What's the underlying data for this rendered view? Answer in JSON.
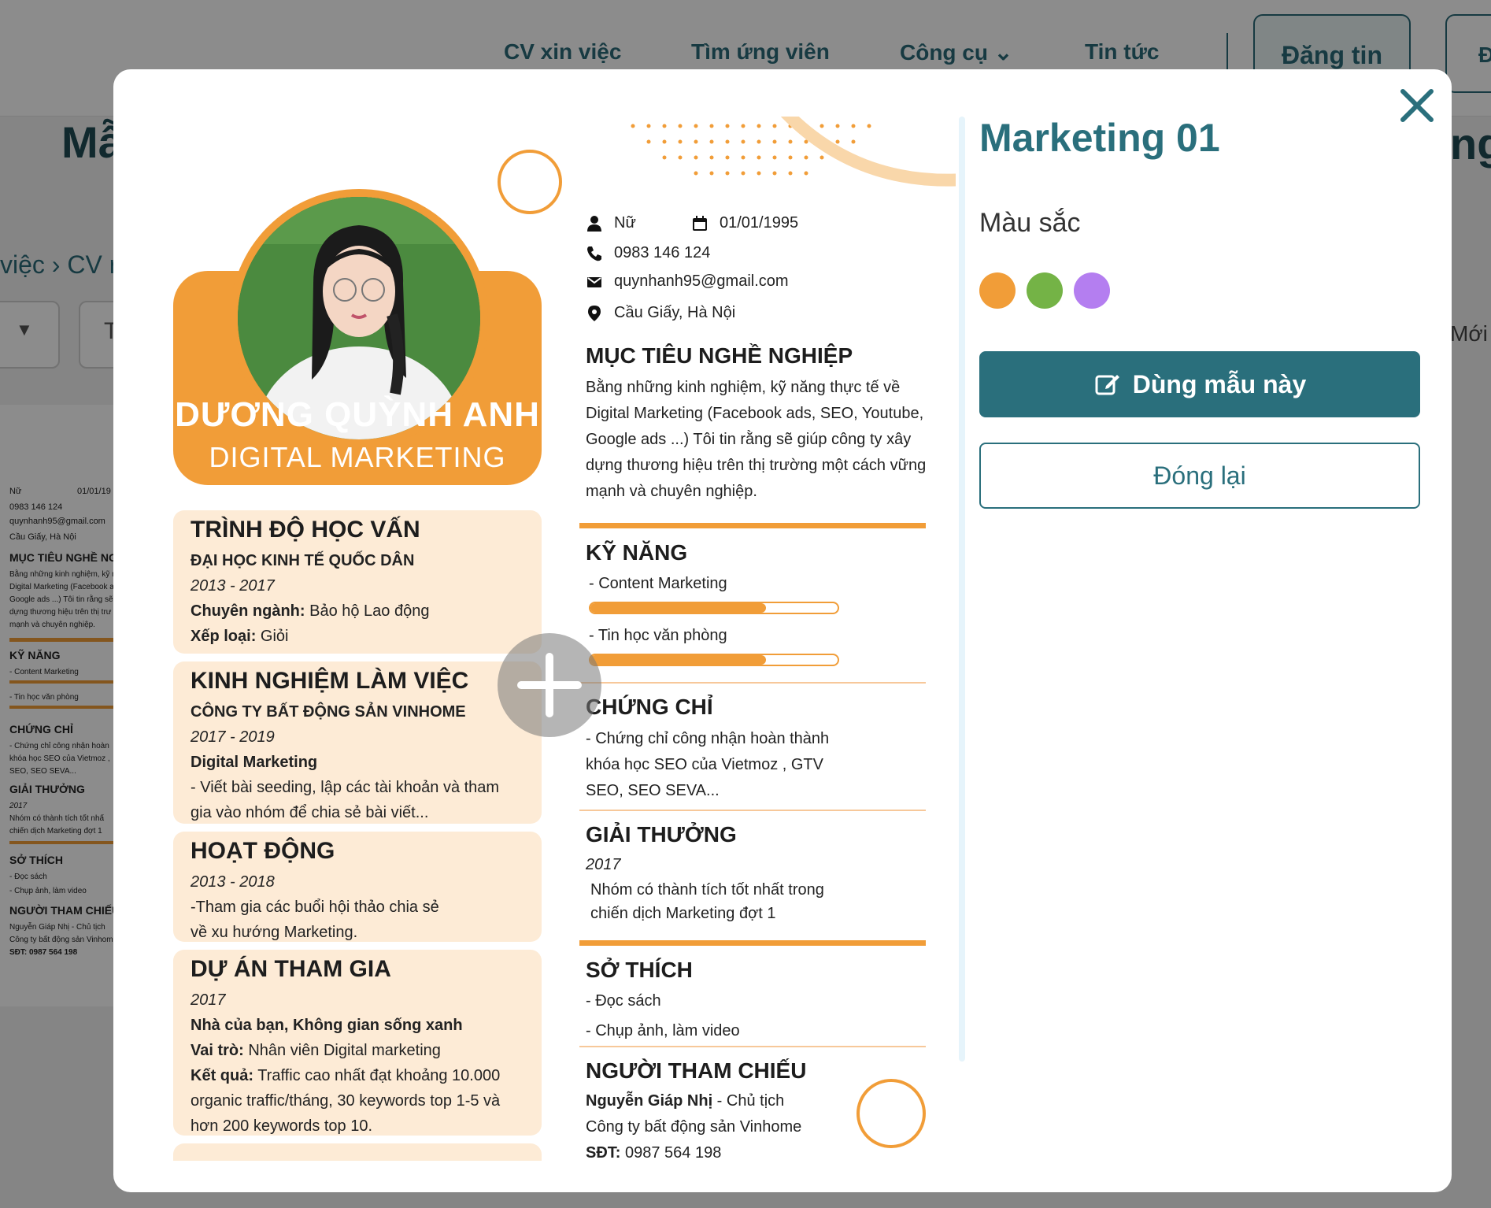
{
  "background": {
    "nav": [
      "CV xin việc",
      "Tìm ứng viên",
      "Công cụ",
      "Tin tức"
    ],
    "post_button": "Đăng tin",
    "login_partial": "Đ",
    "title_partial": "Mẫ",
    "title_right_partial": "ng",
    "breadcrumb": "việc › CV r",
    "select_partial": "T",
    "sort_label": "Mới",
    "thumb": {
      "gender": "Nữ",
      "dob": "01/01/19",
      "phone": "0983 146 124",
      "email": "quynhanh95@gmail.com",
      "address": "Cầu Giấy, Hà Nội",
      "objective_h": "MỤC TIÊU NGHỀ NG",
      "obj1": "Bằng những kinh nghiệm, kỹ n",
      "obj2": "Digital Marketing (Facebook a",
      "obj3": "Google ads ...) Tôi tin rằng sẽ g",
      "obj4": "dựng thương hiệu trên thị trư",
      "obj5": "mạnh và chuyên nghiệp.",
      "skills_h": "KỸ NĂNG",
      "skill1": "- Content Marketing",
      "skill2": "- Tin học văn phòng",
      "cert_h": "CHỨNG CHỈ",
      "cert1": "- Chứng chỉ công nhận hoàn",
      "cert2": "khóa học SEO của Vietmoz ,",
      "cert3": "SEO, SEO SEVA...",
      "award_h": "GIẢI THƯỞNG",
      "award_year": "2017",
      "award1": "Nhóm có thành tích tốt nhấ",
      "award2": "chiến dịch Marketing đợt 1",
      "hobby_h": "SỞ THÍCH",
      "hobby1": "- Đọc sách",
      "hobby2": "- Chụp ảnh, làm video",
      "ref_h": "NGƯỜI THAM CHIẾU",
      "ref1": "Nguyễn Giáp Nhị - Chủ tịch",
      "ref2": "Công ty bất động sản Vinhom",
      "ref3": "SĐT: 0987 564 198"
    }
  },
  "modal": {
    "template_title": "Marketing 01",
    "color_label": "Màu sắc",
    "colors": [
      "#f19d38",
      "#74b346",
      "#b47ef0"
    ],
    "use_button": "Dùng mẫu này",
    "close_button": "Đóng lại"
  },
  "cv": {
    "name": "DƯƠNG QUỲNH ANH",
    "role": "DIGITAL MARKETING",
    "gender": "Nữ",
    "dob": "01/01/1995",
    "phone": "0983 146 124",
    "email": "quynhanh95@gmail.com",
    "address": "Cầu Giấy, Hà Nội",
    "objective": {
      "heading": "MỤC TIÊU NGHỀ NGHIỆP",
      "lines": [
        "Bằng những kinh nghiệm, kỹ năng thực tế về",
        "Digital Marketing (Facebook ads, SEO, Youtube,",
        "Google ads ...) Tôi tin rằng sẽ giúp công ty xây",
        "dựng thương hiệu trên thị trường một cách vững",
        "mạnh và chuyên nghiệp."
      ]
    },
    "skills": {
      "heading": "KỸ NĂNG",
      "items": [
        {
          "name": "- Content Marketing",
          "level": 0.71
        },
        {
          "name": "- Tin học văn phòng",
          "level": 0.71
        }
      ]
    },
    "certificates": {
      "heading": "CHỨNG CHỈ",
      "lines": [
        "- Chứng chỉ công nhận hoàn thành",
        "khóa học SEO của Vietmoz , GTV",
        "SEO, SEO SEVA..."
      ]
    },
    "awards": {
      "heading": "GIẢI THƯỞNG",
      "year": "2017",
      "lines": [
        "Nhóm có thành tích tốt nhất trong",
        "chiến dịch Marketing đợt 1"
      ]
    },
    "hobbies": {
      "heading": "SỞ THÍCH",
      "lines": [
        "- Đọc sách",
        "- Chụp ảnh, làm video"
      ]
    },
    "references": {
      "heading": "NGƯỜI THAM CHIẾU",
      "name": "Nguyễn Giáp Nhị",
      "title": " - Chủ tịch",
      "company": "Công ty bất động sản Vinhome",
      "phone_label": "SĐT:",
      "phone": " 0987 564 198"
    },
    "education": {
      "heading": "TRÌNH ĐỘ HỌC VẤN",
      "school": "ĐẠI HỌC KINH TẾ QUỐC DÂN",
      "years": "2013 - 2017",
      "major_label": "Chuyên ngành:",
      "major": " Bảo hộ Lao động",
      "grade_label": "Xếp loại:",
      "grade": " Giỏi"
    },
    "experience": {
      "heading": "KINH NGHIỆM LÀM VIỆC",
      "company": "CÔNG TY BẤT ĐỘNG SẢN VINHOME",
      "years": "2017 - 2019",
      "position": "Digital Marketing",
      "lines": [
        "-  Viết bài seeding, lập các tài khoản và tham",
        "gia vào nhóm để chia sẻ bài viết..."
      ]
    },
    "activities": {
      "heading": "HOẠT ĐỘNG",
      "years": "2013 - 2018",
      "lines": [
        "-Tham gia các buổi hội thảo chia sẻ",
        "về xu hướng Marketing."
      ]
    },
    "projects": {
      "heading": "DỰ ÁN THAM GIA",
      "year": "2017",
      "project": "Nhà của bạn, Không gian sống xanh",
      "role_label": "Vai trò:",
      "role": " Nhân viên Digital marketing",
      "result_label": "Kết quả:",
      "result_lines": [
        " Traffic cao nhất đạt khoảng 10.000",
        "organic traffic/tháng, 30 keywords top 1-5 và",
        "hơn 200 keywords top 10."
      ]
    }
  }
}
